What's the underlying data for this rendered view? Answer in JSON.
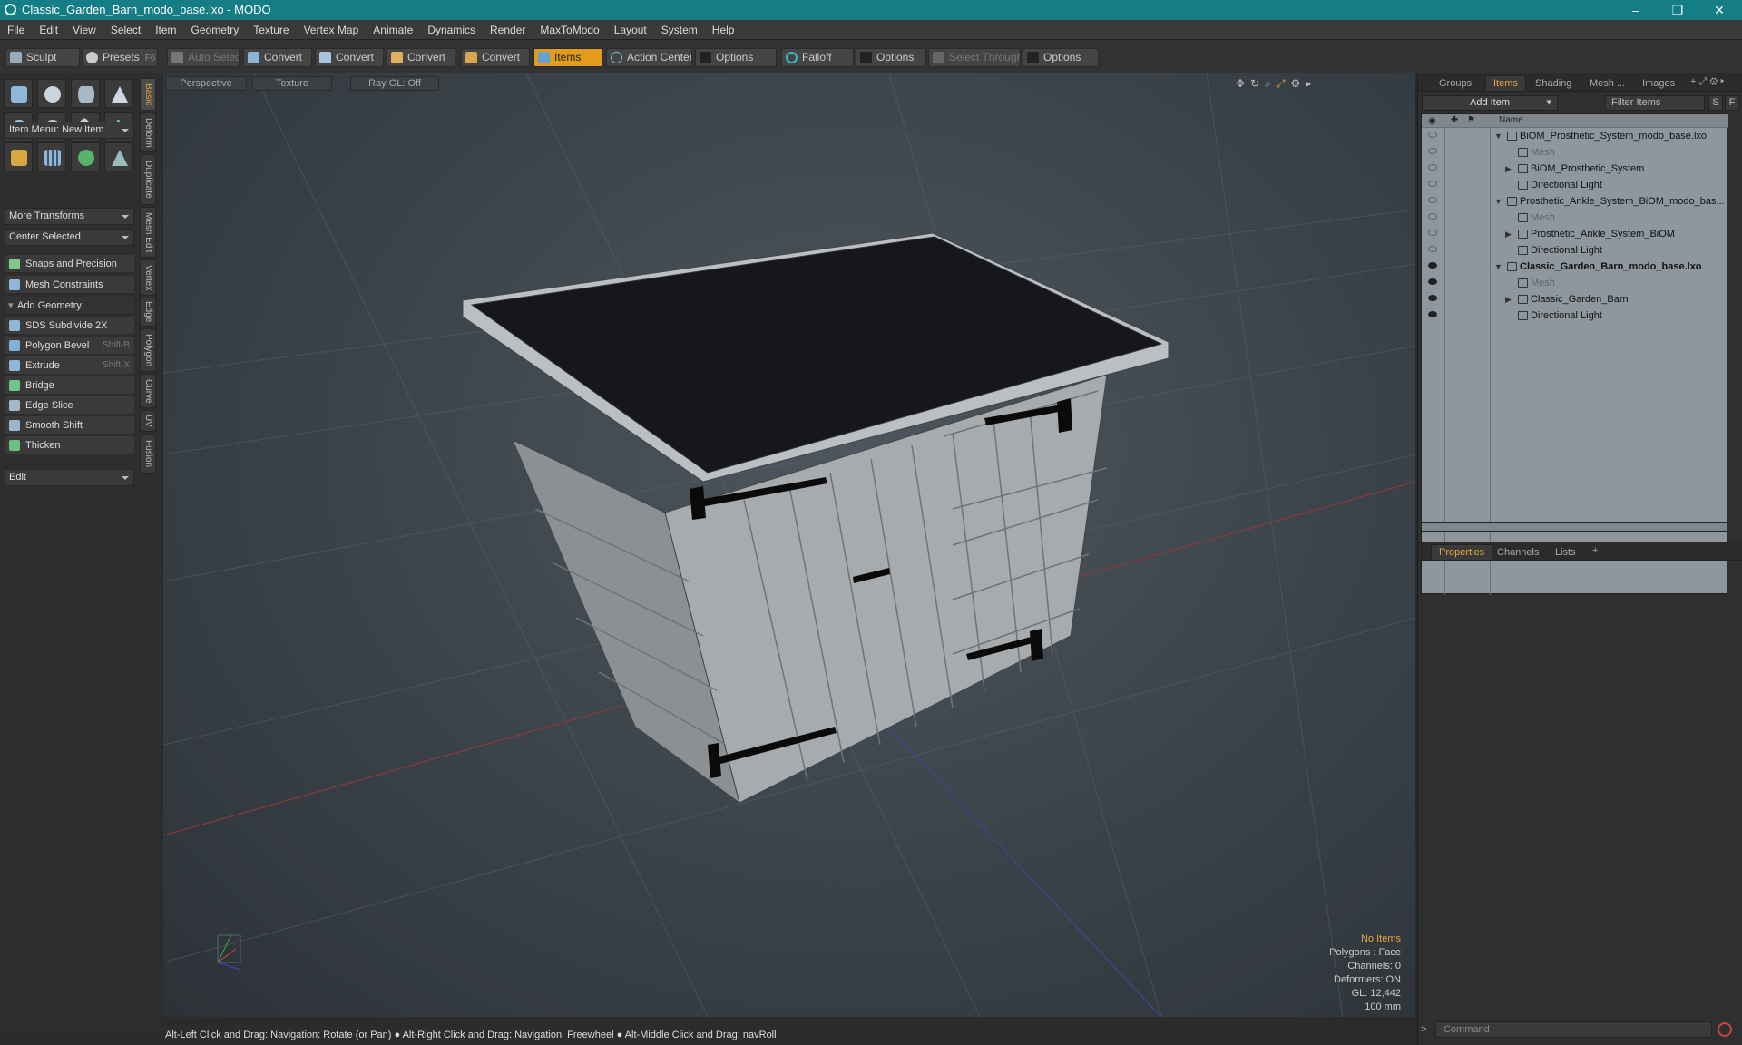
{
  "window": {
    "title": "Classic_Garden_Barn_modo_base.lxo - MODO",
    "minimize": "–",
    "restore": "❐",
    "close": "✕"
  },
  "menu": [
    "File",
    "Edit",
    "View",
    "Select",
    "Item",
    "Geometry",
    "Texture",
    "Vertex Map",
    "Animate",
    "Dynamics",
    "Render",
    "MaxToModo",
    "Layout",
    "System",
    "Help"
  ],
  "toolbar": {
    "sculpt": "Sculpt",
    "presets": "Presets",
    "presets_key": "F6",
    "auto_select": "Auto Select",
    "convert1": "Convert",
    "convert2": "Convert",
    "convert3": "Convert",
    "convert4": "Convert",
    "items": "Items",
    "action_center": "Action Center",
    "options1": "Options",
    "falloff": "Falloff",
    "options2": "Options",
    "select_through": "Select Through",
    "options3": "Options"
  },
  "left": {
    "item_menu": "Item Menu: New Item",
    "more_transforms": "More Transforms",
    "center_selected": "Center Selected",
    "snaps": "Snaps and Precision",
    "mesh_constraints": "Mesh Constraints",
    "add_geometry": "Add Geometry",
    "tools": [
      {
        "label": "SDS Subdivide 2X",
        "shortcut": ""
      },
      {
        "label": "Polygon Bevel",
        "shortcut": "Shift-B"
      },
      {
        "label": "Extrude",
        "shortcut": "Shift-X"
      },
      {
        "label": "Bridge",
        "shortcut": ""
      },
      {
        "label": "Edge Slice",
        "shortcut": ""
      },
      {
        "label": "Smooth Shift",
        "shortcut": ""
      },
      {
        "label": "Thicken",
        "shortcut": ""
      }
    ],
    "edit": "Edit",
    "vtabs": [
      "Basic",
      "Deform",
      "Duplicate",
      "Mesh Edit",
      "Vertex",
      "Edge",
      "Polygon",
      "Curve",
      "UV",
      "Fusion"
    ]
  },
  "viewport": {
    "tabs": [
      "Perspective",
      "Texture",
      "Ray GL: Off"
    ],
    "info": {
      "items": "No Items",
      "polygons": "Polygons : Face",
      "channels": "Channels: 0",
      "deformers": "Deformers: ON",
      "gl": "GL: 12,442",
      "scale": "100 mm"
    },
    "axis_y": "Y"
  },
  "status": "Alt-Left Click and Drag: Navigation: Rotate (or Pan) ● Alt-Right Click and Drag: Navigation: Freewheel ● Alt-Middle Click and Drag: navRoll",
  "right": {
    "tabs": [
      "Groups",
      "Items",
      "Shading",
      "Mesh ...",
      "Images"
    ],
    "add_item": "Add Item",
    "filter": "Filter Items",
    "filter_s": "S",
    "filter_f": "F",
    "col_name": "Name",
    "items": [
      {
        "label": "BiOM_Prosthetic_System_modo_base.lxo",
        "level": 0,
        "type": "scene",
        "visible": false,
        "expand": "▼"
      },
      {
        "label": "Mesh",
        "level": 1,
        "type": "mesh",
        "visible": false,
        "expand": ""
      },
      {
        "label": "BiOM_Prosthetic_System",
        "level": 1,
        "type": "group",
        "visible": false,
        "expand": "▶"
      },
      {
        "label": "Directional Light",
        "level": 1,
        "type": "light",
        "visible": false,
        "expand": ""
      },
      {
        "label": "Prosthetic_Ankle_System_BiOM_modo_bas...",
        "level": 0,
        "type": "scene",
        "visible": false,
        "expand": "▼"
      },
      {
        "label": "Mesh",
        "level": 1,
        "type": "mesh",
        "visible": false,
        "expand": ""
      },
      {
        "label": "Prosthetic_Ankle_System_BiOM",
        "level": 1,
        "type": "group",
        "visible": false,
        "expand": "▶"
      },
      {
        "label": "Directional Light",
        "level": 1,
        "type": "light",
        "visible": false,
        "expand": ""
      },
      {
        "label": "Classic_Garden_Barn_modo_base.lxo",
        "level": 0,
        "type": "scene",
        "visible": true,
        "expand": "▼"
      },
      {
        "label": "Mesh",
        "level": 1,
        "type": "mesh",
        "visible": true,
        "expand": ""
      },
      {
        "label": "Classic_Garden_Barn",
        "level": 1,
        "type": "group",
        "visible": true,
        "expand": "▶"
      },
      {
        "label": "Directional Light",
        "level": 1,
        "type": "light",
        "visible": true,
        "expand": ""
      }
    ],
    "props_tabs": [
      "Properties",
      "Channels",
      "Lists"
    ],
    "command_placeholder": "Command"
  },
  "colors": {
    "accent": "#e39b1c",
    "titlebar": "#157d86"
  }
}
